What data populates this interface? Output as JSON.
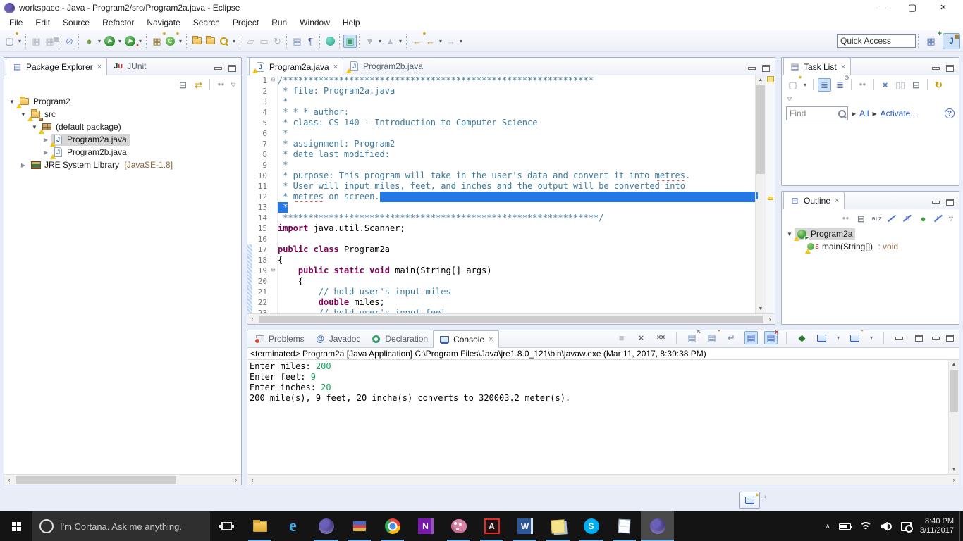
{
  "window": {
    "title": "workspace - Java - Program2/src/Program2a.java - Eclipse",
    "controls": [
      "minimize",
      "maximize",
      "close"
    ]
  },
  "menu": [
    "File",
    "Edit",
    "Source",
    "Refactor",
    "Navigate",
    "Search",
    "Project",
    "Run",
    "Window",
    "Help"
  ],
  "toolbar": {
    "quick_access_placeholder": "Quick Access",
    "icons": [
      "new",
      "dropdown",
      "sep",
      "save",
      "save-all",
      "sep",
      "skip-breakpoints",
      "sep",
      "debug",
      "dropdown",
      "run",
      "dropdown",
      "profile",
      "dropdown",
      "sep",
      "new-java-project",
      "new-java-class",
      "dropdown",
      "sep",
      "open-task",
      "open-resource",
      "java-search",
      "dropdown",
      "sep",
      "externalize-strings",
      "clean-up",
      "refresh-disabled",
      "sep",
      "show-source",
      "show-paragraph",
      "sep",
      "server-sphere",
      "sep",
      "coverage",
      "sep",
      "next-annotation",
      "dropdown",
      "prev-annotation",
      "dropdown",
      "sep",
      "last-edit-location",
      "back",
      "dropdown",
      "forward",
      "dropdown"
    ],
    "right_icons": [
      "open-perspective",
      "java-perspective"
    ]
  },
  "package_explorer": {
    "tabs": [
      {
        "label": "Package Explorer",
        "icon": "package-explorer",
        "active": true,
        "closable": true
      },
      {
        "label": "JUnit",
        "icon": "junit",
        "active": false
      }
    ],
    "view_toolbar": [
      "collapse-all",
      "link-with-editor",
      "vsep",
      "focus",
      "view-menu"
    ],
    "tree": [
      {
        "level": 0,
        "expanded": true,
        "icon": "project",
        "label": "Program2",
        "warning": true
      },
      {
        "level": 1,
        "expanded": true,
        "icon": "src-folder",
        "label": "src",
        "warning": true
      },
      {
        "level": 2,
        "expanded": true,
        "icon": "package",
        "label": "(default package)",
        "warning": true
      },
      {
        "level": 3,
        "expanded": false,
        "icon": "java-file",
        "label": "Program2a.java",
        "warning": true,
        "selected": true
      },
      {
        "level": 3,
        "expanded": false,
        "icon": "java-file",
        "label": "Program2b.java",
        "warning": true
      },
      {
        "level": 1,
        "expanded": false,
        "icon": "jre-library",
        "label": "JRE System Library",
        "qualifier": " [JavaSE-1.8]"
      }
    ]
  },
  "editor": {
    "tabs": [
      {
        "label": "Program2a.java",
        "icon": "java-file",
        "warning": true,
        "active": true,
        "closable": true
      },
      {
        "label": "Program2b.java",
        "icon": "java-file",
        "warning": true,
        "active": false
      }
    ],
    "lines": [
      {
        "n": 1,
        "fold": true,
        "seg": [
          [
            "c",
            "/*************************************************************"
          ]
        ]
      },
      {
        "n": 2,
        "seg": [
          [
            "c",
            " * file: Program2a.java"
          ]
        ]
      },
      {
        "n": 3,
        "seg": [
          [
            "c",
            " *"
          ]
        ]
      },
      {
        "n": 4,
        "seg": [
          [
            "c",
            " * * * author: "
          ]
        ]
      },
      {
        "n": 5,
        "seg": [
          [
            "c",
            " * class: CS 140 - Introduction to Computer Science"
          ]
        ]
      },
      {
        "n": 6,
        "seg": [
          [
            "c",
            " *"
          ]
        ]
      },
      {
        "n": 7,
        "seg": [
          [
            "c",
            " * assignment: Program2"
          ]
        ]
      },
      {
        "n": 8,
        "seg": [
          [
            "c",
            " * date last modified:"
          ]
        ]
      },
      {
        "n": 9,
        "seg": [
          [
            "c",
            " *"
          ]
        ]
      },
      {
        "n": 10,
        "seg": [
          [
            "c",
            " * purpose: This program will take in the user's data and convert it into "
          ],
          [
            "c mis",
            "metres"
          ],
          [
            "c",
            "."
          ]
        ]
      },
      {
        "n": 11,
        "seg": [
          [
            "c",
            " * User will input miles, feet, and inches and the output will be converted into"
          ]
        ]
      },
      {
        "n": 12,
        "selToEol": true,
        "seg": [
          [
            "c",
            " * "
          ],
          [
            "c mis",
            "metres"
          ],
          [
            "c",
            " on screen."
          ]
        ]
      },
      {
        "n": 13,
        "seg": [
          [
            "sel",
            " *"
          ]
        ]
      },
      {
        "n": 14,
        "seg": [
          [
            "c",
            " **************************************************************/"
          ]
        ]
      },
      {
        "n": 15,
        "seg": [
          [
            "k",
            "import"
          ],
          [
            "p",
            " java.util.Scanner;"
          ]
        ]
      },
      {
        "n": 16,
        "seg": []
      },
      {
        "n": 17,
        "changed": true,
        "seg": [
          [
            "k",
            "public"
          ],
          [
            "p",
            " "
          ],
          [
            "k",
            "class"
          ],
          [
            "p",
            " Program2a"
          ]
        ]
      },
      {
        "n": 18,
        "changed": true,
        "seg": [
          [
            "p",
            "{"
          ]
        ]
      },
      {
        "n": 19,
        "changed": true,
        "fold": true,
        "seg": [
          [
            "p",
            "    "
          ],
          [
            "k",
            "public"
          ],
          [
            "p",
            " "
          ],
          [
            "k",
            "static"
          ],
          [
            "p",
            " "
          ],
          [
            "k",
            "void"
          ],
          [
            "p",
            " main(String[] args)"
          ]
        ]
      },
      {
        "n": 20,
        "changed": true,
        "seg": [
          [
            "p",
            "    {"
          ]
        ]
      },
      {
        "n": 21,
        "changed": true,
        "seg": [
          [
            "p",
            "        "
          ],
          [
            "c",
            "// hold user's input miles"
          ]
        ]
      },
      {
        "n": 22,
        "changed": true,
        "seg": [
          [
            "p",
            "        "
          ],
          [
            "k",
            "double"
          ],
          [
            "p",
            " miles;"
          ]
        ]
      },
      {
        "n": 23,
        "changed": true,
        "seg": [
          [
            "p",
            "        "
          ],
          [
            "c",
            "// hold user's input feet"
          ]
        ]
      }
    ]
  },
  "task_list": {
    "tab": "Task List",
    "view_toolbar": [
      "new-task",
      "dropdown",
      "vsep",
      "categorized",
      "scheduled",
      "vsep",
      "focus",
      "vsep",
      "filter",
      "group",
      "collapse-all2",
      "vsep",
      "synchronize"
    ],
    "find_placeholder": "Find",
    "links": [
      "All",
      "Activate..."
    ],
    "help": "?"
  },
  "outline": {
    "tab": "Outline",
    "view_toolbar": [
      "focus",
      "collapse-all",
      "sort",
      "hide-fields",
      "hide-static",
      "hide-non-public",
      "hide-local-types",
      "view-menu"
    ],
    "items": [
      {
        "level": 0,
        "expanded": true,
        "icon": "class-runnable",
        "label": "Program2a",
        "warning": true,
        "selected": true
      },
      {
        "level": 1,
        "icon": "method-static",
        "label": "main(String[])",
        "type": " : void",
        "warning": true
      }
    ]
  },
  "console": {
    "tabs": [
      {
        "label": "Problems",
        "icon": "problems"
      },
      {
        "label": "Javadoc",
        "icon": "javadoc"
      },
      {
        "label": "Declaration",
        "icon": "declaration"
      },
      {
        "label": "Console",
        "icon": "console",
        "active": true,
        "closable": true
      }
    ],
    "view_toolbar": [
      "terminate",
      "remove-launch",
      "remove-all-terminated",
      "vsep",
      "clear",
      "scroll-lock",
      "word-wrap",
      "show-stdout",
      "show-stderr",
      "vsep",
      "pin",
      "display-selected",
      "dropdown",
      "open-console",
      "dropdown",
      "vsep",
      "minimize-view",
      "maximize-view"
    ],
    "status": "<terminated> Program2a [Java Application] C:\\Program Files\\Java\\jre1.8.0_121\\bin\\javaw.exe (Mar 11, 2017, 8:39:38 PM)",
    "lines": [
      [
        [
          "p",
          "Enter miles: "
        ],
        [
          "in",
          "200"
        ]
      ],
      [
        [
          "p",
          "Enter feet: "
        ],
        [
          "in",
          "9"
        ]
      ],
      [
        [
          "p",
          "Enter inches: "
        ],
        [
          "in",
          "20"
        ]
      ],
      [
        [
          "p",
          "200 mile(s), 9 feet, 20 inche(s) converts to 320003.2 meter(s)."
        ]
      ]
    ]
  },
  "statusbar": {
    "launcher_icon": "whats-new"
  },
  "taskbar": {
    "cortana_text": "I'm Cortana. Ask me anything.",
    "apps": [
      {
        "name": "task-view"
      },
      {
        "name": "file-explorer",
        "running": true
      },
      {
        "name": "edge"
      },
      {
        "name": "eclipse-launcher",
        "running": true
      },
      {
        "name": "winrar",
        "running": true
      },
      {
        "name": "chrome",
        "running": true
      },
      {
        "name": "onenote"
      },
      {
        "name": "paint",
        "running": true
      },
      {
        "name": "adobe-reader",
        "running": true
      },
      {
        "name": "word",
        "running": true
      },
      {
        "name": "sticky-notes",
        "running": true
      },
      {
        "name": "skype",
        "running": true
      },
      {
        "name": "notepad",
        "running": true
      },
      {
        "name": "eclipse",
        "active": true
      }
    ],
    "tray_icons": [
      "chevron-up",
      "battery",
      "wifi",
      "volume",
      "action-center"
    ],
    "clock": {
      "time": "8:40 PM",
      "date": "3/11/2017"
    }
  }
}
